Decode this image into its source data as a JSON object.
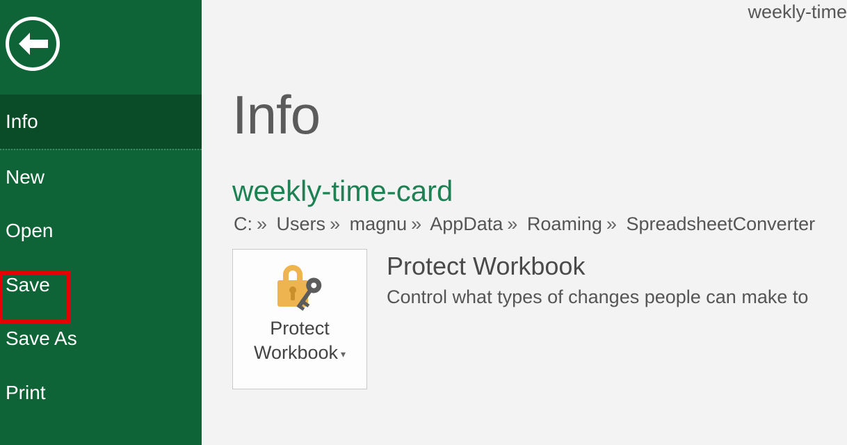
{
  "titlebar": {
    "filename_truncated": "weekly-time"
  },
  "sidebar": {
    "items": [
      {
        "label": "Info",
        "active": true
      },
      {
        "label": "New",
        "active": false
      },
      {
        "label": "Open",
        "active": false
      },
      {
        "label": "Save",
        "active": false,
        "highlighted": true
      },
      {
        "label": "Save As",
        "active": false
      },
      {
        "label": "Print",
        "active": false
      }
    ]
  },
  "page": {
    "heading": "Info",
    "document_name": "weekly-time-card",
    "path_segments": [
      "C:",
      "Users",
      "magnu",
      "AppData",
      "Roaming",
      "SpreadsheetConverter"
    ],
    "protect_tile": {
      "line1": "Protect",
      "line2": "Workbook"
    },
    "protect_section": {
      "title": "Protect Workbook",
      "description": "Control what types of changes people can make to"
    }
  },
  "colors": {
    "excel_green": "#0e6436",
    "excel_green_dark": "#0a4b28",
    "accent_green": "#1d8153",
    "highlight_red": "#e60000"
  }
}
